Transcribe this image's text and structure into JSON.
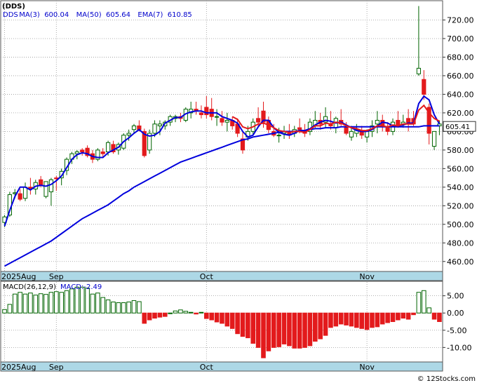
{
  "chart_data": [
    {
      "type": "candlestick",
      "title": "(DDS)",
      "legend": [
        {
          "label": "DDS",
          "color": "#0000cc"
        },
        {
          "label": "MA(3)",
          "value": "600.04",
          "color": "#0000cc"
        },
        {
          "label": "MA(50)",
          "value": "605.64",
          "color": "#0000cc"
        },
        {
          "label": "EMA(7)",
          "value": "610.85",
          "color": "#0000cc"
        }
      ],
      "last_price_label": "605.41",
      "ylim": [
        450,
        740
      ],
      "yticks": [
        460,
        480,
        500,
        520,
        540,
        560,
        580,
        600,
        620,
        640,
        660,
        680,
        700,
        720
      ],
      "x_axis_labels": [
        {
          "label": "2025Aug",
          "index": 0
        },
        {
          "label": "Sep",
          "index": 10
        },
        {
          "label": "Oct",
          "index": 39
        },
        {
          "label": "Nov",
          "index": 70
        }
      ],
      "ohlc": [
        [
          502,
          510,
          497,
          508
        ],
        [
          510,
          535,
          508,
          532
        ],
        [
          533,
          538,
          528,
          534
        ],
        [
          533,
          538,
          525,
          527
        ],
        [
          528,
          545,
          525,
          540
        ],
        [
          540,
          550,
          532,
          538
        ],
        [
          538,
          548,
          532,
          545
        ],
        [
          548,
          552,
          540,
          542
        ],
        [
          530,
          545,
          528,
          546
        ],
        [
          535,
          550,
          520,
          548
        ],
        [
          550,
          552,
          536,
          549
        ],
        [
          550,
          560,
          542,
          557
        ],
        [
          558,
          572,
          553,
          570
        ],
        [
          570,
          578,
          565,
          576
        ],
        [
          576,
          580,
          570,
          578
        ],
        [
          580,
          582,
          574,
          578
        ],
        [
          582,
          585,
          572,
          574
        ],
        [
          576,
          580,
          566,
          570
        ],
        [
          570,
          582,
          568,
          580
        ],
        [
          578,
          582,
          572,
          576
        ],
        [
          578,
          590,
          574,
          588
        ],
        [
          586,
          590,
          576,
          578
        ],
        [
          580,
          588,
          575,
          586
        ],
        [
          582,
          598,
          580,
          596
        ],
        [
          596,
          602,
          590,
          598
        ],
        [
          602,
          608,
          598,
          606
        ],
        [
          606,
          612,
          600,
          602
        ],
        [
          600,
          603,
          572,
          574
        ],
        [
          580,
          602,
          576,
          598
        ],
        [
          598,
          612,
          594,
          608
        ],
        [
          606,
          612,
          596,
          608
        ],
        [
          606,
          612,
          602,
          610
        ],
        [
          610,
          618,
          606,
          616
        ],
        [
          614,
          618,
          610,
          616
        ],
        [
          616,
          620,
          610,
          614
        ],
        [
          612,
          626,
          610,
          624
        ],
        [
          620,
          632,
          614,
          624
        ],
        [
          624,
          632,
          618,
          622
        ],
        [
          620,
          628,
          614,
          618
        ],
        [
          626,
          638,
          614,
          618
        ],
        [
          624,
          636,
          612,
          616
        ],
        [
          616,
          624,
          606,
          616
        ],
        [
          614,
          622,
          606,
          610
        ],
        [
          610,
          620,
          600,
          612
        ],
        [
          612,
          616,
          602,
          606
        ],
        [
          608,
          614,
          594,
          598
        ],
        [
          592,
          600,
          576,
          580
        ],
        [
          594,
          606,
          590,
          600
        ],
        [
          600,
          614,
          596,
          610
        ],
        [
          614,
          626,
          606,
          610
        ],
        [
          622,
          632,
          604,
          610
        ],
        [
          612,
          616,
          598,
          602
        ],
        [
          600,
          608,
          594,
          596
        ],
        [
          596,
          604,
          588,
          596
        ],
        [
          598,
          606,
          592,
          600
        ],
        [
          598,
          608,
          592,
          596
        ],
        [
          598,
          606,
          594,
          602
        ],
        [
          604,
          614,
          598,
          602
        ],
        [
          600,
          608,
          594,
          598
        ],
        [
          600,
          614,
          596,
          610
        ],
        [
          606,
          622,
          604,
          612
        ],
        [
          612,
          620,
          602,
          608
        ],
        [
          610,
          626,
          604,
          616
        ],
        [
          608,
          622,
          602,
          606
        ],
        [
          604,
          616,
          598,
          614
        ],
        [
          612,
          624,
          606,
          608
        ],
        [
          604,
          610,
          596,
          598
        ],
        [
          594,
          606,
          590,
          600
        ],
        [
          598,
          608,
          594,
          602
        ],
        [
          600,
          606,
          592,
          596
        ],
        [
          594,
          602,
          588,
          600
        ],
        [
          600,
          612,
          594,
          606
        ],
        [
          608,
          622,
          598,
          612
        ],
        [
          612,
          618,
          600,
          606
        ],
        [
          604,
          610,
          596,
          600
        ],
        [
          600,
          614,
          596,
          610
        ],
        [
          612,
          622,
          604,
          606
        ],
        [
          608,
          618,
          604,
          610
        ],
        [
          614,
          624,
          600,
          608
        ],
        [
          614,
          622,
          606,
          608
        ],
        [
          662,
          735,
          660,
          668
        ],
        [
          656,
          666,
          634,
          640
        ],
        [
          626,
          630,
          586,
          598
        ],
        [
          584,
          600,
          580,
          600
        ],
        [
          606,
          612,
          596,
          608
        ]
      ],
      "ma3": [
        498,
        515,
        530,
        540,
        540,
        537,
        541,
        542,
        541,
        543,
        547,
        552,
        561,
        570,
        575,
        577,
        576,
        573,
        572,
        572,
        577,
        580,
        583,
        589,
        593,
        598,
        602,
        597,
        595,
        596,
        600,
        609,
        612,
        615,
        615,
        619,
        621,
        622,
        622,
        620,
        620,
        620,
        616,
        614,
        612,
        609,
        600,
        594,
        596,
        605,
        612,
        612,
        604,
        599,
        597,
        596,
        598,
        601,
        601,
        603,
        607,
        610,
        612,
        611,
        609,
        610,
        607,
        604,
        601,
        600,
        600,
        602,
        606,
        610,
        609,
        606,
        606,
        607,
        609,
        609,
        630,
        638,
        634,
        618,
        608
      ],
      "ma50": [
        455,
        458,
        461,
        464,
        467,
        470,
        473,
        476,
        479,
        482,
        486,
        490,
        494,
        498,
        502,
        506,
        509,
        512,
        515,
        518,
        521,
        525,
        529,
        533,
        536,
        540,
        543,
        546,
        549,
        552,
        555,
        558,
        561,
        564,
        567,
        569,
        571,
        573,
        575,
        577,
        579,
        581,
        583,
        585,
        587,
        589,
        591,
        592,
        594,
        595,
        596,
        597,
        598,
        599,
        600,
        600,
        600,
        601,
        601,
        602,
        603,
        603,
        604,
        604,
        604,
        605,
        605,
        605,
        605,
        605,
        605,
        605,
        605,
        605,
        605,
        605,
        605,
        605,
        605,
        605,
        605,
        606,
        606,
        606,
        606
      ],
      "ema7": [
        null,
        null,
        null,
        null,
        null,
        null,
        null,
        null,
        null,
        null,
        null,
        null,
        null,
        null,
        null,
        null,
        null,
        null,
        null,
        null,
        null,
        null,
        null,
        null,
        null,
        null,
        null,
        null,
        null,
        null,
        null,
        null,
        null,
        null,
        null,
        null,
        null,
        null,
        null,
        null,
        null,
        null,
        null,
        null,
        616,
        613,
        605,
        603,
        605,
        608,
        609,
        607,
        604,
        601,
        600,
        599,
        600,
        600,
        599,
        602,
        606,
        606,
        609,
        608,
        610,
        609,
        606,
        604,
        603,
        601,
        601,
        603,
        606,
        606,
        605,
        607,
        606,
        608,
        608,
        608,
        623,
        628,
        620,
        614,
        611
      ],
      "ema7_color": "#e31a1c",
      "up_color": "#006400",
      "down_color": "#e31a1c",
      "ma_color": "#0000dd"
    },
    {
      "type": "bar",
      "title": "MACD(26,12,9)",
      "value_label": "MACD:-2.49",
      "ylim": [
        -14,
        9
      ],
      "yticks": [
        5.0,
        0.0,
        -5.0,
        -10.0
      ],
      "ytick_labels": [
        "5.00",
        "0.00",
        "-5.00",
        "-10.00"
      ],
      "x_axis_labels": [
        {
          "label": "2025Aug",
          "index": 0
        },
        {
          "label": "Sep",
          "index": 10
        },
        {
          "label": "Oct",
          "index": 39
        },
        {
          "label": "Nov",
          "index": 70
        }
      ],
      "values": [
        1.0,
        2.5,
        5.5,
        6.0,
        5.5,
        5.8,
        5.2,
        5.6,
        5.4,
        6.0,
        6.2,
        6.0,
        6.5,
        7.0,
        7.5,
        7.5,
        7.2,
        5.5,
        5.8,
        4.5,
        3.8,
        3.2,
        3.0,
        3.0,
        3.2,
        3.6,
        3.3,
        -3.0,
        -2.0,
        -1.5,
        -1.2,
        -1.0,
        0.0,
        0.6,
        0.9,
        0.5,
        0.2,
        -0.3,
        0.2,
        -1.6,
        -2.0,
        -2.6,
        -3.0,
        -3.8,
        -4.5,
        -6.0,
        -6.8,
        -7.2,
        -8.8,
        -10.0,
        -13.0,
        -11.0,
        -10.0,
        -9.8,
        -9.0,
        -9.5,
        -10.2,
        -10.2,
        -10.0,
        -9.5,
        -8.2,
        -7.5,
        -6.5,
        -4.2,
        -3.8,
        -3.2,
        -3.5,
        -3.8,
        -4.2,
        -4.5,
        -4.8,
        -4.2,
        -4.0,
        -3.2,
        -2.8,
        -2.5,
        -2.0,
        -1.5,
        -1.8,
        -0.5,
        6.0,
        6.5,
        1.5,
        -1.8,
        -2.5
      ],
      "up_color": "#006400",
      "down_color": "#e31a1c"
    }
  ],
  "footer": {
    "text": "© 12Stocks.com"
  }
}
